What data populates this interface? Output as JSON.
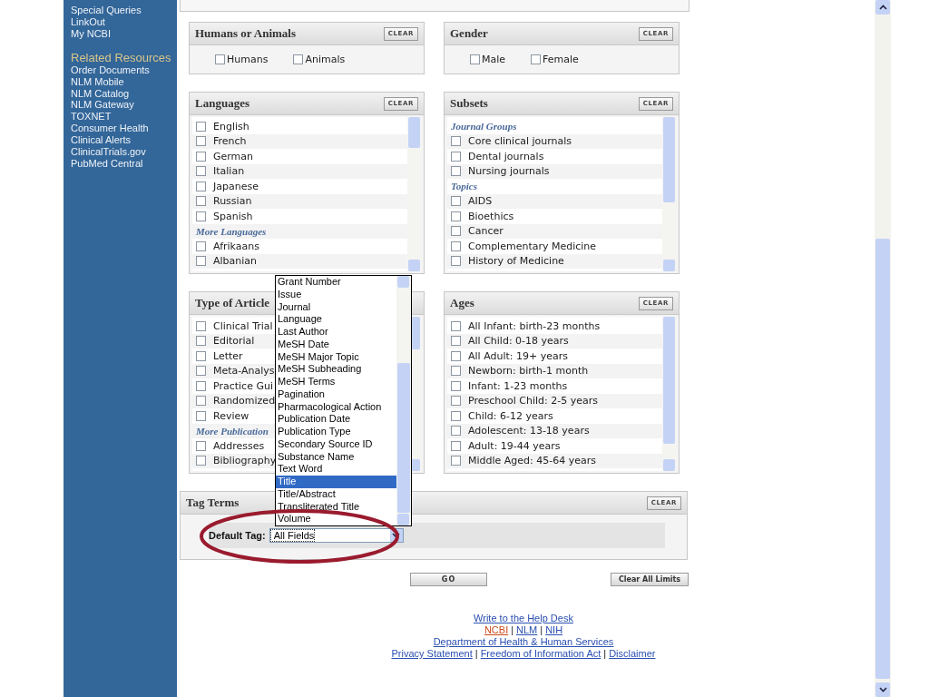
{
  "sidebar": {
    "items": [
      "Special Queries",
      "LinkOut",
      "My NCBI"
    ],
    "related_heading": "Related Resources",
    "related_items": [
      "Order Documents",
      "NLM Mobile",
      "NLM Catalog",
      "NLM Gateway",
      "TOXNET",
      "Consumer Health",
      "Clinical Alerts",
      "ClinicalTrials.gov",
      "PubMed Central"
    ]
  },
  "panels": [
    {
      "title": "Humans or Animals",
      "clear": "CLEAR",
      "kind": "inline",
      "options": [
        {
          "label": "Humans",
          "checked": false
        },
        {
          "label": "Animals",
          "checked": false
        }
      ]
    },
    {
      "title": "Gender",
      "clear": "CLEAR",
      "kind": "inline",
      "options": [
        {
          "label": "Male",
          "checked": false
        },
        {
          "label": "Female",
          "checked": false
        }
      ]
    },
    {
      "title": "Languages",
      "clear": "CLEAR",
      "kind": "list",
      "rows": [
        {
          "kind": "option",
          "label": "English",
          "checked": false
        },
        {
          "kind": "option",
          "label": "French",
          "checked": false
        },
        {
          "kind": "option",
          "label": "German",
          "checked": false
        },
        {
          "kind": "option",
          "label": "Italian",
          "checked": false
        },
        {
          "kind": "option",
          "label": "Japanese",
          "checked": false
        },
        {
          "kind": "option",
          "label": "Russian",
          "checked": false
        },
        {
          "kind": "option",
          "label": "Spanish",
          "checked": false
        },
        {
          "kind": "group",
          "label": "More Languages"
        },
        {
          "kind": "option",
          "label": "Afrikaans",
          "checked": false
        },
        {
          "kind": "option",
          "label": "Albanian",
          "checked": false
        }
      ]
    },
    {
      "title": "Subsets",
      "clear": "CLEAR",
      "kind": "list",
      "rows": [
        {
          "kind": "group",
          "label": "Journal Groups"
        },
        {
          "kind": "option",
          "label": "Core clinical journals",
          "checked": false
        },
        {
          "kind": "option",
          "label": "Dental journals",
          "checked": false
        },
        {
          "kind": "option",
          "label": "Nursing journals",
          "checked": false
        },
        {
          "kind": "group",
          "label": "Topics"
        },
        {
          "kind": "option",
          "label": "AIDS",
          "checked": false
        },
        {
          "kind": "option",
          "label": "Bioethics",
          "checked": false
        },
        {
          "kind": "option",
          "label": "Cancer",
          "checked": false
        },
        {
          "kind": "option",
          "label": "Complementary Medicine",
          "checked": false
        },
        {
          "kind": "option",
          "label": "History of Medicine",
          "checked": false
        }
      ]
    },
    {
      "title": "Type of Article",
      "kind": "list",
      "rows": [
        {
          "kind": "option",
          "label": "Clinical Trial",
          "checked": false
        },
        {
          "kind": "option",
          "label": "Editorial",
          "checked": false
        },
        {
          "kind": "option",
          "label": "Letter",
          "checked": false
        },
        {
          "kind": "option",
          "label": "Meta-Analys",
          "checked": false
        },
        {
          "kind": "option",
          "label": "Practice Gui",
          "checked": false
        },
        {
          "kind": "option",
          "label": "Randomized",
          "checked": false
        },
        {
          "kind": "option",
          "label": "Review",
          "checked": false
        },
        {
          "kind": "group",
          "label": "More Publication"
        },
        {
          "kind": "option",
          "label": "Addresses",
          "checked": false
        },
        {
          "kind": "option",
          "label": "Bibliography",
          "checked": false
        }
      ]
    },
    {
      "title": "Ages",
      "clear": "CLEAR",
      "kind": "list",
      "rows": [
        {
          "kind": "option",
          "label": "All Infant: birth-23 months",
          "checked": false
        },
        {
          "kind": "option",
          "label": "All Child: 0-18 years",
          "checked": false
        },
        {
          "kind": "option",
          "label": "All Adult: 19+ years",
          "checked": false
        },
        {
          "kind": "option",
          "label": "Newborn: birth-1 month",
          "checked": false
        },
        {
          "kind": "option",
          "label": "Infant: 1-23 months",
          "checked": false
        },
        {
          "kind": "option",
          "label": "Preschool Child: 2-5 years",
          "checked": false
        },
        {
          "kind": "option",
          "label": "Child: 6-12 years",
          "checked": false
        },
        {
          "kind": "option",
          "label": "Adolescent: 13-18 years",
          "checked": false
        },
        {
          "kind": "option",
          "label": "Adult: 19-44 years",
          "checked": false
        },
        {
          "kind": "option",
          "label": "Middle Aged: 45-64 years",
          "checked": false
        }
      ]
    }
  ],
  "tag_terms": {
    "title": "Tag Terms",
    "clear": "CLEAR",
    "label": "Default Tag:",
    "value": "All Fields",
    "options": [
      {
        "label": "Grant Number",
        "selected": false
      },
      {
        "label": "Issue",
        "selected": false
      },
      {
        "label": "Journal",
        "selected": false
      },
      {
        "label": "Language",
        "selected": false
      },
      {
        "label": "Last Author",
        "selected": false
      },
      {
        "label": "MeSH Date",
        "selected": false
      },
      {
        "label": "MeSH Major Topic",
        "selected": false
      },
      {
        "label": "MeSH Subheading",
        "selected": false
      },
      {
        "label": "MeSH Terms",
        "selected": false
      },
      {
        "label": "Pagination",
        "selected": false
      },
      {
        "label": "Pharmacological Action",
        "selected": false
      },
      {
        "label": "Publication Date",
        "selected": false
      },
      {
        "label": "Publication Type",
        "selected": false
      },
      {
        "label": "Secondary Source ID",
        "selected": false
      },
      {
        "label": "Substance Name",
        "selected": false
      },
      {
        "label": "Text Word",
        "selected": false
      },
      {
        "label": "Title",
        "selected": true
      },
      {
        "label": "Title/Abstract",
        "selected": false
      },
      {
        "label": "Transliterated Title",
        "selected": false
      },
      {
        "label": "Volume",
        "selected": false
      }
    ]
  },
  "go_button": "GO",
  "clear_all_button": "Clear All Limits",
  "footer": [
    {
      "links": [
        {
          "text": "Write to the Help Desk",
          "color": "#2a4fb0"
        }
      ]
    },
    {
      "separator": "|",
      "links": [
        {
          "text": "NCBI",
          "color": "#cc4a1a"
        },
        {
          "text": "NLM",
          "color": "#2a4fb0"
        },
        {
          "text": "NIH",
          "color": "#2a4fb0"
        }
      ]
    },
    {
      "links": [
        {
          "text": "Department of Health & Human Services",
          "color": "#2a4fb0"
        }
      ]
    },
    {
      "separator": "|",
      "links": [
        {
          "text": "Privacy Statement",
          "color": "#2a4fb0"
        },
        {
          "text": "Freedom of Information Act",
          "color": "#2a4fb0"
        },
        {
          "text": "Disclaimer",
          "color": "#2a4fb0"
        }
      ]
    }
  ]
}
